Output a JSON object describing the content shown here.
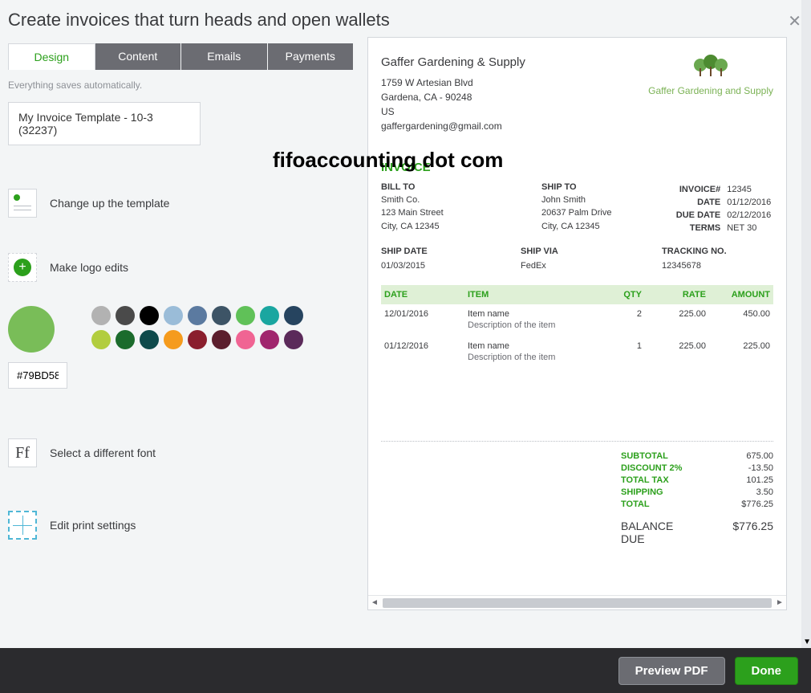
{
  "header": {
    "title": "Create invoices that turn heads and open wallets"
  },
  "tabs": [
    "Design",
    "Content",
    "Emails",
    "Payments"
  ],
  "autosave": "Everything saves automatically.",
  "template_select": "My Invoice Template - 10-3 (32237)",
  "options": {
    "template": "Change up the template",
    "logo": "Make logo edits",
    "font": "Select a different font",
    "print": "Edit print settings"
  },
  "colors": {
    "selected_hex": "#79BD58",
    "swatches": [
      "#b2b2b2",
      "#4a4a4a",
      "#000000",
      "#9abcd8",
      "#5b7aa0",
      "#3d5466",
      "#60c158",
      "#1aa6a0",
      "#26445f",
      "#b2cd3e",
      "#1b6b2c",
      "#0e4a4b",
      "#f59b1d",
      "#8a1e2d",
      "#5b1e2d",
      "#f06493",
      "#a0256d",
      "#5b2a5a"
    ]
  },
  "font_icon": "Ff",
  "overlay": "fifoaccounting dot com",
  "invoice": {
    "company": {
      "name": "Gaffer Gardening & Supply",
      "addr1": "1759 W Artesian Blvd",
      "addr2": "Gardena, CA - 90248",
      "country": "US",
      "email": "gaffergardening@gmail.com",
      "logo_text": "Gaffer Gardening and Supply"
    },
    "title": "INVOICE",
    "billto": {
      "label": "BILL TO",
      "l1": "Smith Co.",
      "l2": "123 Main Street",
      "l3": "City, CA 12345"
    },
    "shipto": {
      "label": "SHIP TO",
      "l1": "John Smith",
      "l2": "20637 Palm Drive",
      "l3": "City, CA 12345"
    },
    "meta": {
      "invoice_no_lbl": "INVOICE#",
      "invoice_no": "12345",
      "date_lbl": "DATE",
      "date": "01/12/2016",
      "due_lbl": "DUE DATE",
      "due": "02/12/2016",
      "terms_lbl": "TERMS",
      "terms": "NET 30"
    },
    "ship": {
      "date_lbl": "SHIP DATE",
      "date": "01/03/2015",
      "via_lbl": "SHIP VIA",
      "via": "FedEx",
      "track_lbl": "TRACKING NO.",
      "track": "12345678"
    },
    "cols": {
      "date": "DATE",
      "item": "ITEM",
      "qty": "QTY",
      "rate": "RATE",
      "amount": "AMOUNT"
    },
    "lines": [
      {
        "date": "12/01/2016",
        "item": "Item name",
        "desc": "Description of the item",
        "qty": "2",
        "rate": "225.00",
        "amount": "450.00"
      },
      {
        "date": "01/12/2016",
        "item": "Item name",
        "desc": "Description of the item",
        "qty": "1",
        "rate": "225.00",
        "amount": "225.00"
      }
    ],
    "totals": {
      "subtotal_lbl": "SUBTOTAL",
      "subtotal": "675.00",
      "discount_lbl": "DISCOUNT 2%",
      "discount": "-13.50",
      "tax_lbl": "TOTAL TAX",
      "tax": "101.25",
      "shipping_lbl": "SHIPPING",
      "shipping": "3.50",
      "total_lbl": "TOTAL",
      "total": "$776.25",
      "balance_lbl": "BALANCE DUE",
      "balance": "$776.25"
    }
  },
  "footer": {
    "preview": "Preview PDF",
    "done": "Done"
  }
}
